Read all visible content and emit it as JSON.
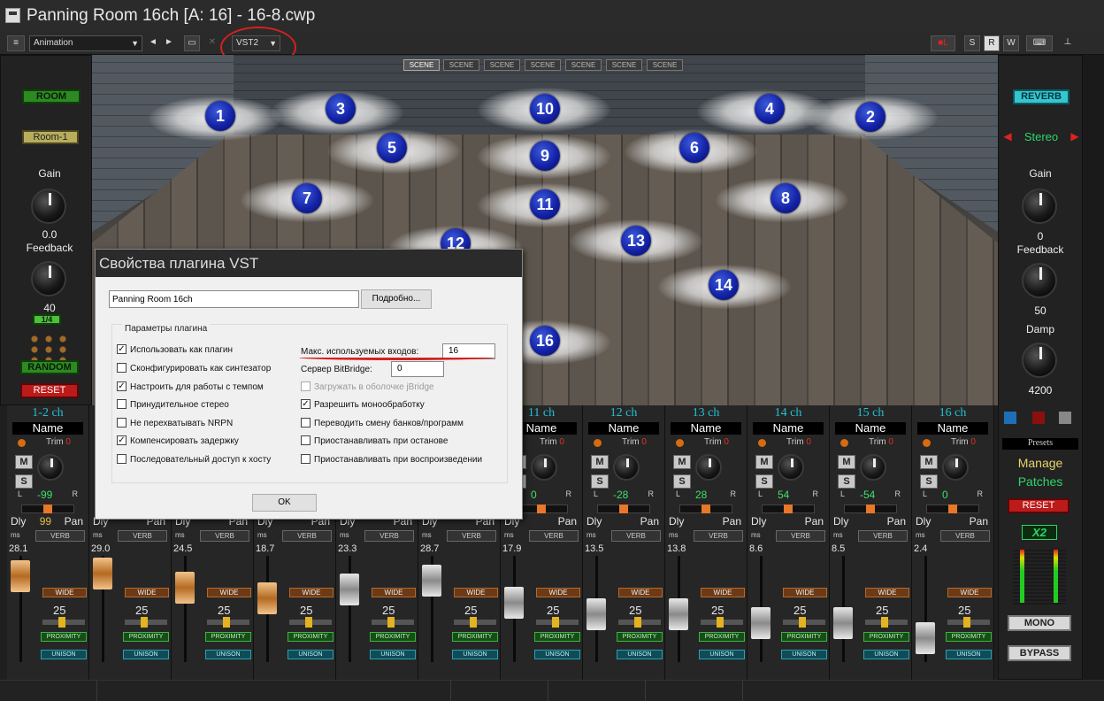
{
  "window": {
    "title": "Panning Room 16ch [A: 16] - 16-8.cwp"
  },
  "toolbar": {
    "preset": "Animation",
    "plugin_format": "VST2",
    "buttons": [
      "S",
      "R",
      "W"
    ]
  },
  "scenes": [
    "SCENE",
    "SCENE",
    "SCENE",
    "SCENE",
    "SCENE",
    "SCENE",
    "SCENE"
  ],
  "speakers": [
    "1",
    "2",
    "3",
    "4",
    "5",
    "6",
    "7",
    "8",
    "9",
    "10",
    "11",
    "12",
    "13",
    "14",
    "16"
  ],
  "left_panel": {
    "room_button": "ROOM",
    "room_preset": "Room-1",
    "gain_label": "Gain",
    "gain_value": "0.0",
    "feedback_label": "Feedback",
    "feedback_value": "40",
    "ratio": "1/4",
    "random_button": "RANDOM",
    "reset_button": "RESET"
  },
  "right_panel": {
    "reverb_button": "REVERB",
    "mode": "Stereo",
    "gain_label": "Gain",
    "gain_value": "0",
    "feedback_label": "Feedback",
    "feedback_value": "50",
    "damp_label": "Damp",
    "damp_value": "4200",
    "presets_label": "Presets",
    "manage": "Manage",
    "patches": "Patches",
    "reset_button": "RESET",
    "x2": "X2",
    "mono_button": "MONO",
    "bypass_button": "BYPASS",
    "colors": {
      "accent_cyan": "#35c6cf",
      "red": "#bd1a1a"
    }
  },
  "mixer": {
    "name_label": "Name",
    "trim_label": "Trim",
    "trim_value": "0",
    "mute": "M",
    "solo": "S",
    "dly": "Dly",
    "pan": "Pan",
    "verb": "VERB",
    "ms": "ms",
    "wide": "WIDE",
    "width_value": "25",
    "proximity": "PROXIMITY",
    "unison": "UNISON",
    "channels": [
      {
        "name": "1-2 ch",
        "pan": "-99",
        "dly_value": "99",
        "db": "28.1",
        "fader": "orange"
      },
      {
        "name": "",
        "pan": "",
        "dly_value": "",
        "db": "29.0",
        "fader": "orange"
      },
      {
        "name": "",
        "pan": "",
        "dly_value": "",
        "db": "24.5",
        "fader": "orange"
      },
      {
        "name": "",
        "pan": "",
        "dly_value": "",
        "db": "18.7",
        "fader": "orange"
      },
      {
        "name": "",
        "pan": "",
        "dly_value": "",
        "db": "23.3",
        "fader": "grey"
      },
      {
        "name": "",
        "pan": "",
        "dly_value": "",
        "db": "28.7",
        "fader": "grey"
      },
      {
        "name": "11 ch",
        "pan": "0",
        "dly_value": "",
        "db": "17.9",
        "fader": "grey"
      },
      {
        "name": "12 ch",
        "pan": "-28",
        "dly_value": "",
        "db": "13.5",
        "fader": "grey"
      },
      {
        "name": "13 ch",
        "pan": "28",
        "dly_value": "",
        "db": "13.8",
        "fader": "grey"
      },
      {
        "name": "14 ch",
        "pan": "54",
        "dly_value": "",
        "db": "8.6",
        "fader": "grey"
      },
      {
        "name": "15 ch",
        "pan": "-54",
        "dly_value": "",
        "db": "8.5",
        "fader": "grey"
      },
      {
        "name": "16 ch",
        "pan": "0",
        "dly_value": "",
        "db": "2.4",
        "fader": "grey"
      }
    ]
  },
  "dialog": {
    "title": "Свойства плагина VST",
    "plugin_name": "Panning Room 16ch",
    "more_button": "Подробно...",
    "group_label": "Параметры плагина",
    "left_options": [
      {
        "label": "Использовать как плагин",
        "checked": true
      },
      {
        "label": "Сконфигурировать как синтезатор",
        "checked": false
      },
      {
        "label": "Настроить для работы с темпом",
        "checked": true
      },
      {
        "label": "Принудительное стерео",
        "checked": false
      },
      {
        "label": "Не перехватывать NRPN",
        "checked": false
      },
      {
        "label": "Компенсировать задержку",
        "checked": true
      },
      {
        "label": "Последовательный доступ к хосту",
        "checked": false
      }
    ],
    "max_inputs_label": "Макс. используемых входов:",
    "max_inputs_value": "16",
    "bitbridge_label": "Сервер BitBridge:",
    "bitbridge_value": "0",
    "right_options": [
      {
        "label": "Загружать в оболочке jBridge",
        "checked": false,
        "disabled": true
      },
      {
        "label": "Разрешить монообработку",
        "checked": true,
        "disabled": false
      },
      {
        "label": "Переводить смену банков/программ",
        "checked": false,
        "disabled": false
      },
      {
        "label": "Приостанавливать при останове",
        "checked": false,
        "disabled": false
      },
      {
        "label": "Приостанавливать при воспроизведении",
        "checked": false,
        "disabled": false
      }
    ],
    "ok_button": "OK"
  }
}
